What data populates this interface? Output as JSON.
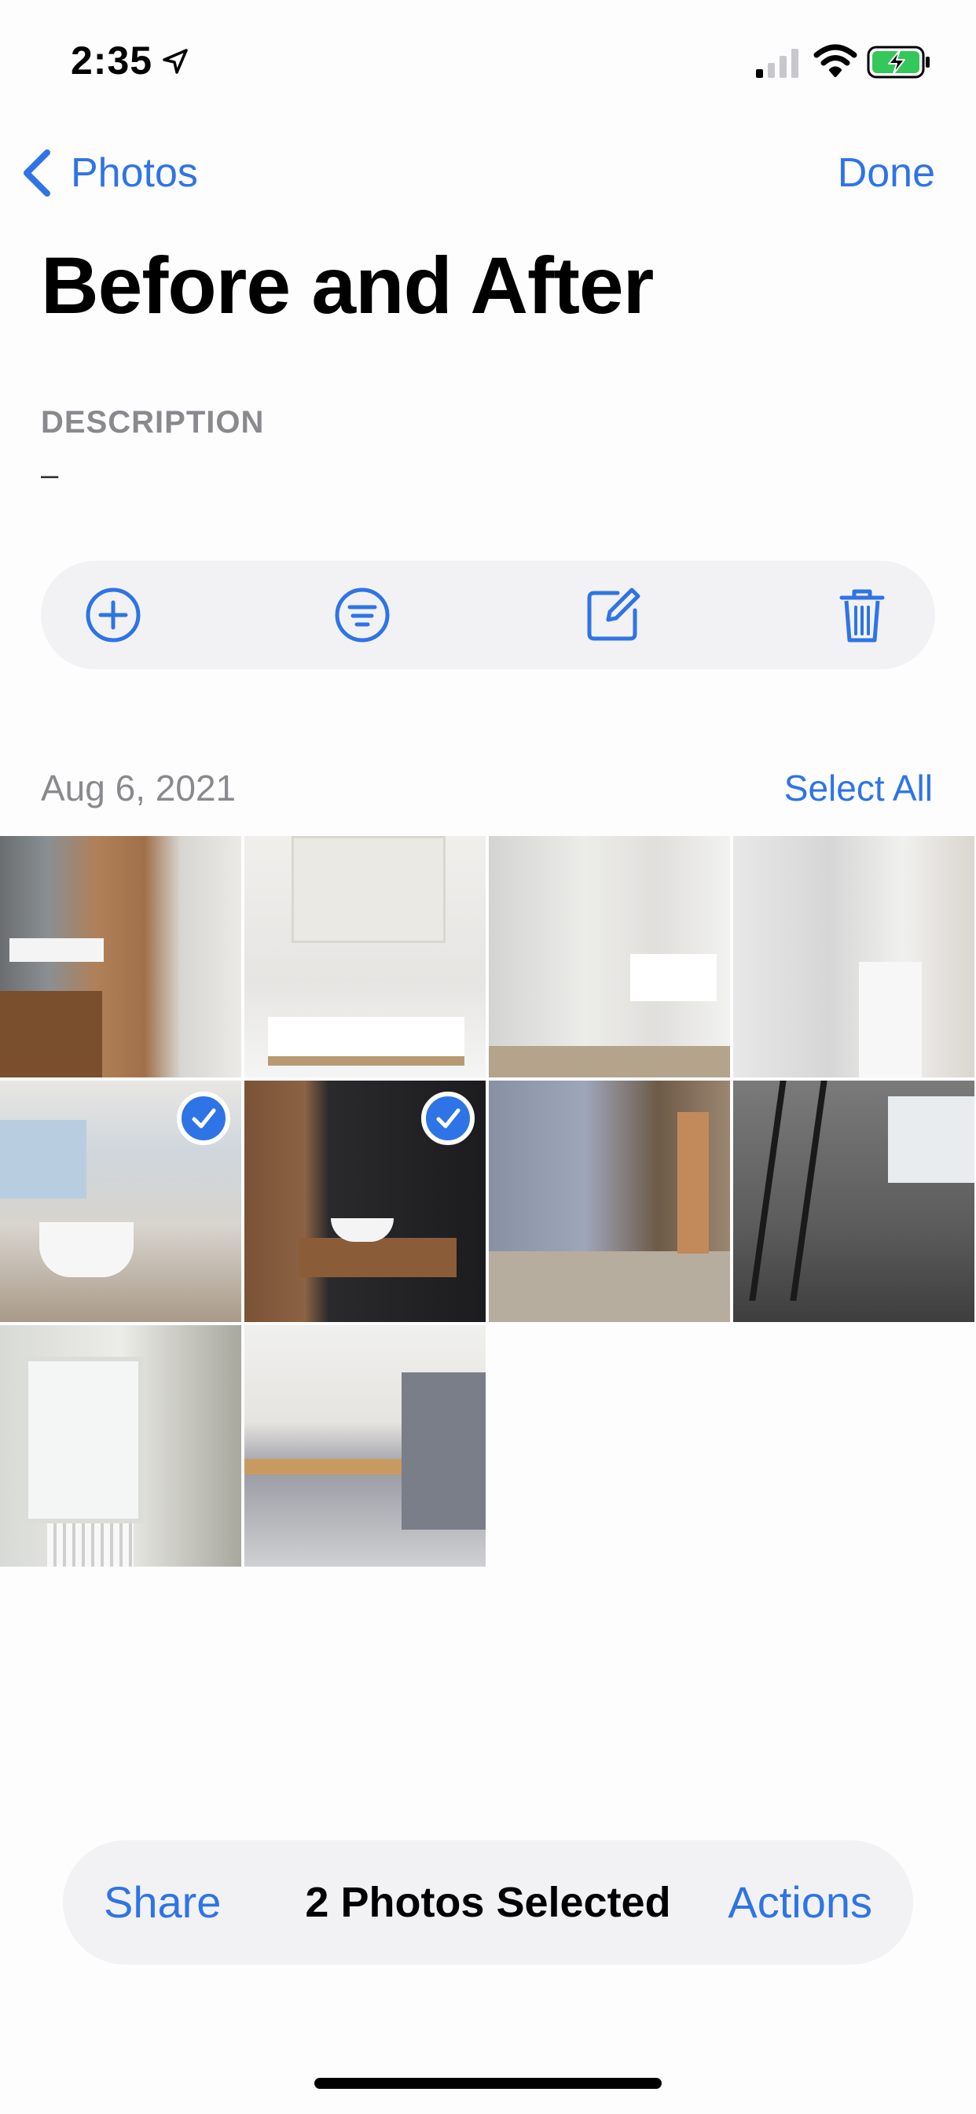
{
  "status_bar": {
    "time": "2:35"
  },
  "nav": {
    "back_label": "Photos",
    "done_label": "Done"
  },
  "album": {
    "title": "Before and After",
    "description_label": "DESCRIPTION",
    "description_value": "–"
  },
  "toolbar": {
    "icons": [
      "add-circle-icon",
      "filter-icon",
      "edit-icon",
      "trash-icon"
    ]
  },
  "section": {
    "date": "Aug 6, 2021",
    "select_all_label": "Select All"
  },
  "photos": [
    {
      "subject": "bathroom-wood-towel-rack",
      "selected": false
    },
    {
      "subject": "bathroom-sink-cabinet",
      "selected": false
    },
    {
      "subject": "bathroom-glass-shower",
      "selected": false
    },
    {
      "subject": "bathroom-marble-shower",
      "selected": false
    },
    {
      "subject": "bathroom-bathtub-window",
      "selected": true
    },
    {
      "subject": "bathroom-black-marble",
      "selected": true
    },
    {
      "subject": "renovation-ladders",
      "selected": false
    },
    {
      "subject": "renovation-room-ladder",
      "selected": false
    },
    {
      "subject": "window-renovation",
      "selected": false
    },
    {
      "subject": "kitchen-modern",
      "selected": false
    }
  ],
  "bottom_bar": {
    "share_label": "Share",
    "selection_text": "2 Photos Selected",
    "actions_label": "Actions"
  },
  "colors": {
    "accent": "#2f74e6",
    "secondary_text": "#8a8a8e",
    "pill_bg": "#f2f2f5"
  }
}
